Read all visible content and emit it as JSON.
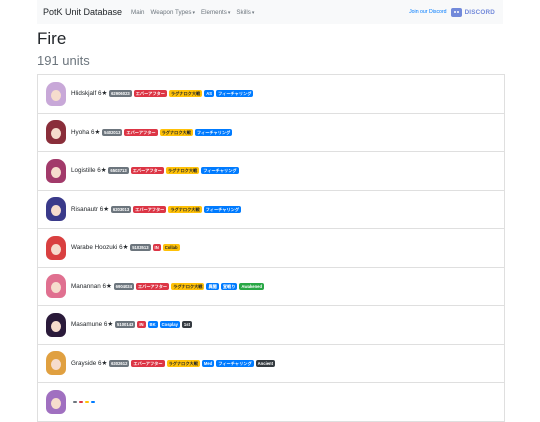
{
  "navbar": {
    "brand": "PotK Unit Database",
    "links": [
      {
        "label": "Main"
      },
      {
        "label": "Weapon Types"
      },
      {
        "label": "Elements"
      },
      {
        "label": "Skills"
      }
    ],
    "join_label": "Join our Discord",
    "discord_label": "DISCORD"
  },
  "page": {
    "title": "Fire",
    "count": "191 units"
  },
  "units": [
    {
      "name": "Hlidskjalf 6★",
      "avatar_color": "#c8a8d8",
      "badges": [
        {
          "text": "62906023",
          "color": "gray"
        },
        {
          "text": "エバーアフター",
          "color": "red"
        },
        {
          "text": "ラグナロク大戦",
          "color": "yellow"
        },
        {
          "text": "AS",
          "color": "blue"
        },
        {
          "text": "フィーチャリング",
          "color": "blue"
        }
      ]
    },
    {
      "name": "Hyoha 6★",
      "avatar_color": "#8a2e3a",
      "badges": [
        {
          "text": "5402013",
          "color": "gray"
        },
        {
          "text": "エバーアフター",
          "color": "red"
        },
        {
          "text": "ラグナロク大戦",
          "color": "yellow"
        },
        {
          "text": "フィーチャリング",
          "color": "blue"
        }
      ]
    },
    {
      "name": "Logistille 6★",
      "avatar_color": "#a23a6a",
      "badges": [
        {
          "text": "6503713",
          "color": "gray"
        },
        {
          "text": "エバーアフター",
          "color": "red"
        },
        {
          "text": "ラグナロク大戦",
          "color": "yellow"
        },
        {
          "text": "フィーチャリング",
          "color": "blue"
        }
      ]
    },
    {
      "name": "Risanautr 6★",
      "avatar_color": "#3a3a8a",
      "badges": [
        {
          "text": "6203013",
          "color": "gray"
        },
        {
          "text": "エバーアフター",
          "color": "red"
        },
        {
          "text": "ラグナロク大戦",
          "color": "yellow"
        },
        {
          "text": "フィーチャリング",
          "color": "blue"
        }
      ]
    },
    {
      "name": "Warabe Hoozuki 6★",
      "avatar_color": "#d94040",
      "badges": [
        {
          "text": "5103513",
          "color": "gray"
        },
        {
          "text": "IN",
          "color": "red"
        },
        {
          "text": "Collab",
          "color": "yellow"
        }
      ]
    },
    {
      "name": "Manannan 6★",
      "avatar_color": "#e07090",
      "badges": [
        {
          "text": "6904024",
          "color": "gray"
        },
        {
          "text": "エバーアフター",
          "color": "red"
        },
        {
          "text": "ラグナロク大戦",
          "color": "yellow"
        },
        {
          "text": "異聞",
          "color": "blue"
        },
        {
          "text": "宣戦り",
          "color": "blue"
        },
        {
          "text": "Awakened",
          "color": "green"
        }
      ]
    },
    {
      "name": "Masamune 6★",
      "avatar_color": "#2a1a3a",
      "badges": [
        {
          "text": "5100143",
          "color": "gray"
        },
        {
          "text": "IN",
          "color": "red"
        },
        {
          "text": "BK",
          "color": "blue"
        },
        {
          "text": "Cosplay",
          "color": "blue"
        },
        {
          "text": "1st",
          "color": "dark"
        }
      ]
    },
    {
      "name": "Grayside 6★",
      "avatar_color": "#e0a040",
      "badges": [
        {
          "text": "6302612",
          "color": "gray"
        },
        {
          "text": "エバーアフター",
          "color": "red"
        },
        {
          "text": "ラグナロク大戦",
          "color": "yellow"
        },
        {
          "text": "Med",
          "color": "blue"
        },
        {
          "text": "フィーチャリング",
          "color": "blue"
        },
        {
          "text": "Ancient",
          "color": "dark"
        }
      ]
    },
    {
      "name": "",
      "avatar_color": "#a070c0",
      "badges": [
        {
          "text": "",
          "color": "gray"
        },
        {
          "text": "",
          "color": "red"
        },
        {
          "text": "",
          "color": "yellow"
        },
        {
          "text": "",
          "color": "blue"
        }
      ]
    }
  ]
}
